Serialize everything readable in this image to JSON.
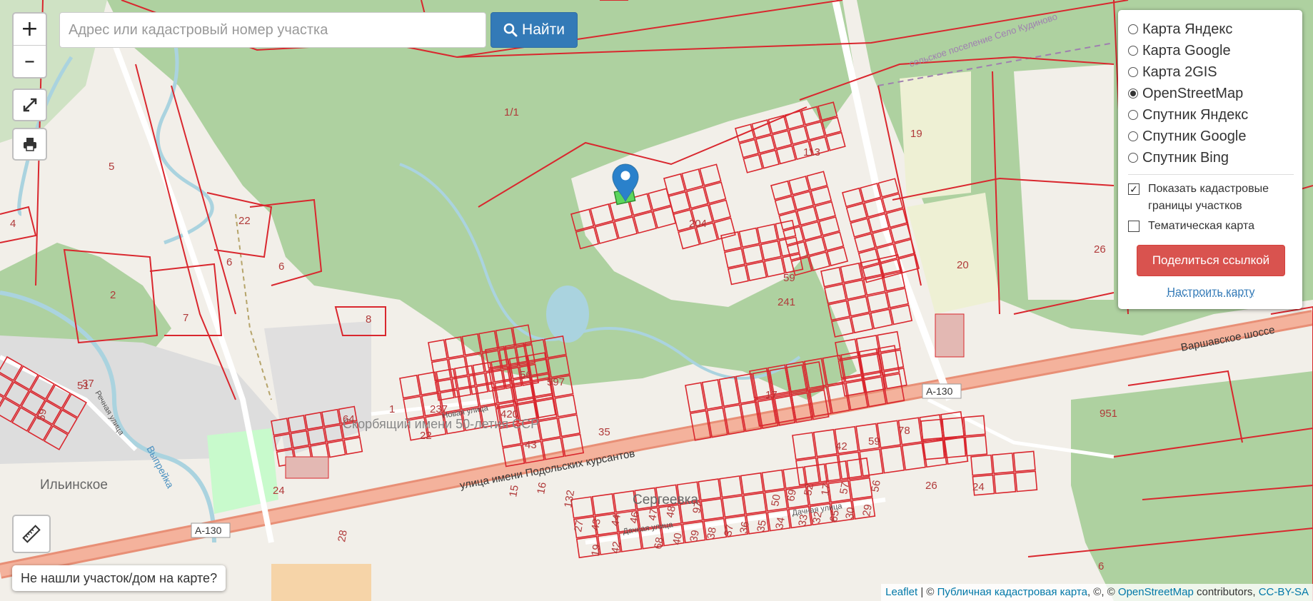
{
  "search": {
    "placeholder": "Адрес или кадастровый номер участка",
    "button_label": "Найти"
  },
  "zoom": {
    "in_label": "+",
    "out_label": "–"
  },
  "layers": {
    "options": [
      {
        "label": "Карта Яндекс",
        "selected": false
      },
      {
        "label": "Карта Google",
        "selected": false
      },
      {
        "label": "Карта 2GIS",
        "selected": false
      },
      {
        "label": "OpenStreetMap",
        "selected": true
      },
      {
        "label": "Спутник Яндекс",
        "selected": false
      },
      {
        "label": "Спутник Google",
        "selected": false
      },
      {
        "label": "Спутник Bing",
        "selected": false
      }
    ],
    "show_cadastral_label": "Показать кадастровые границы участков",
    "show_cadastral_checked": true,
    "thematic_label": "Тематическая карта",
    "thematic_checked": false,
    "share_button": "Поделиться ссылкой",
    "configure_link": "Настроить карту"
  },
  "not_found_button": "Не нашли участок/дом на карте?",
  "attribution": {
    "leaflet": "Leaflet",
    "sep1": " | © ",
    "pkk": "Публичная кадастровая карта",
    "sep2": ", ©, © ",
    "osm": "OpenStreetMap",
    "sep3": " contributors, ",
    "license": "CC-BY-SA"
  },
  "map": {
    "place_labels": [
      {
        "text": "Ильинское"
      },
      {
        "text": "Сергеевка"
      },
      {
        "text": "Скорбящий имени 50-летия ССР"
      }
    ],
    "road_labels": [
      {
        "text": "улица имени Подольских курсантов"
      },
      {
        "text": "Варшавское шоссе"
      },
      {
        "text": "A-130"
      },
      {
        "text": "A-130"
      },
      {
        "text": "сельское поселение Село Кудиново"
      },
      {
        "text": "Выпрейка"
      },
      {
        "text": "Новая улица"
      },
      {
        "text": "Речная улица"
      },
      {
        "text": "Дачная улица"
      },
      {
        "text": "Дачная улица"
      }
    ],
    "parcel_numbers": [
      "1/1",
      "5",
      "4",
      "22",
      "6",
      "6",
      "2",
      "7",
      "8",
      "19",
      "20",
      "26",
      "113",
      "204",
      "59",
      "241",
      "56",
      "597",
      "420",
      "237",
      "1",
      "64",
      "35",
      "43",
      "22",
      "17",
      "42",
      "59",
      "78",
      "951",
      "26",
      "24",
      "24",
      "15",
      "16",
      "132",
      "97",
      "50",
      "69",
      "52",
      "17",
      "57",
      "56",
      "27",
      "43",
      "44",
      "46",
      "47",
      "48",
      "19",
      "42",
      "68",
      "40",
      "39",
      "38",
      "37",
      "36",
      "35",
      "34",
      "33",
      "32",
      "65",
      "30",
      "29",
      "28",
      "59",
      "51",
      "37",
      "6",
      "4",
      "951"
    ],
    "colors": {
      "parcel_line": "#d9272e",
      "forest": "#aed1a0",
      "road": "#f2a18a",
      "water": "#aad3df"
    }
  }
}
